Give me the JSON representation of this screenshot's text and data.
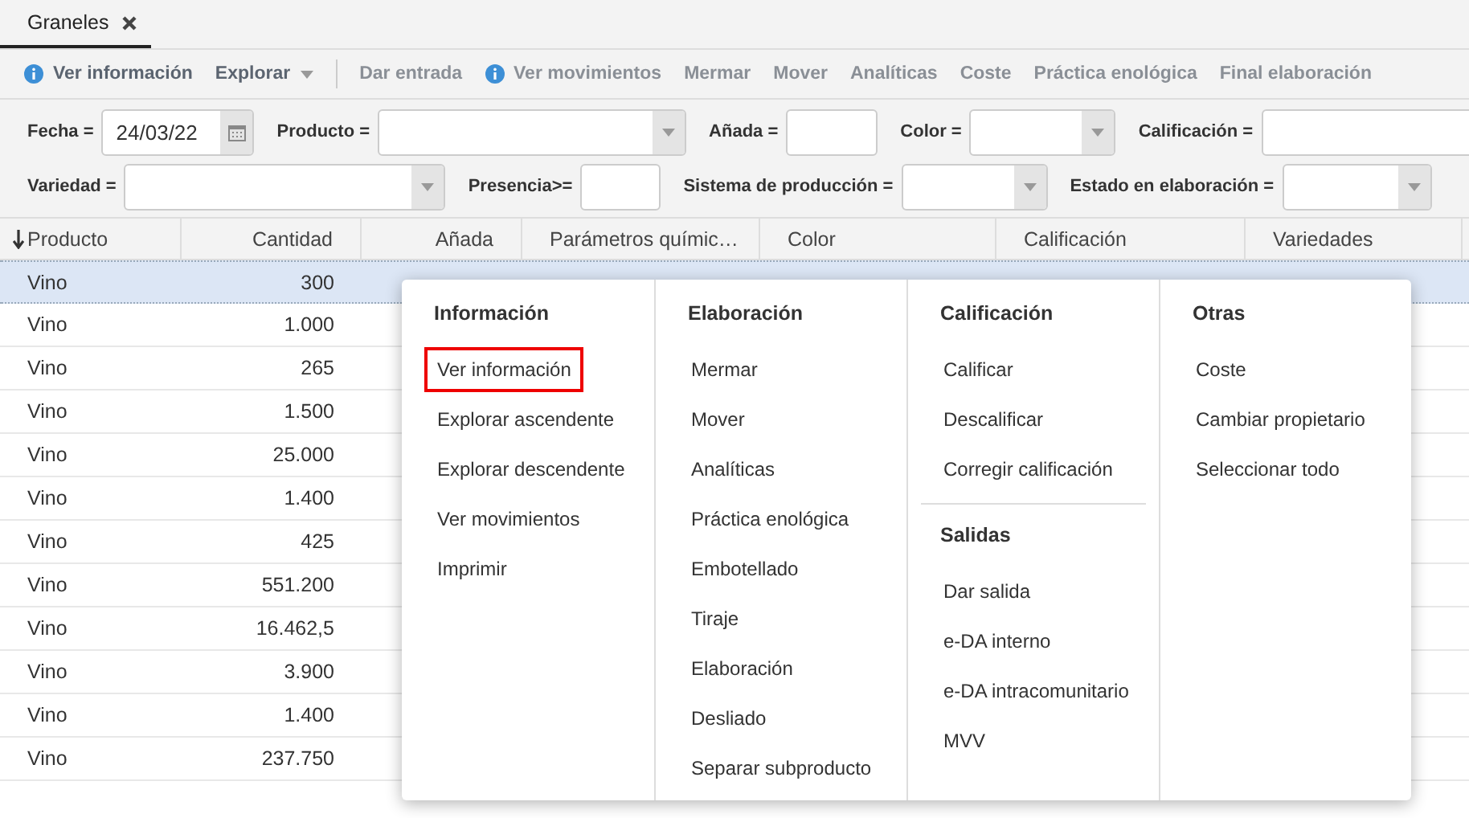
{
  "tabs": [
    {
      "label": "Graneles",
      "selected": true,
      "closable": true
    }
  ],
  "toolbar": [
    {
      "kind": "info",
      "label": "Ver información",
      "disabled": false
    },
    {
      "kind": "dropdown",
      "label": "Explorar",
      "disabled": false
    },
    {
      "kind": "separator"
    },
    {
      "kind": "plain",
      "label": "Dar entrada",
      "disabled": true
    },
    {
      "kind": "info",
      "label": "Ver movimientos",
      "disabled": true
    },
    {
      "kind": "plain",
      "label": "Mermar",
      "disabled": true
    },
    {
      "kind": "plain",
      "label": "Mover",
      "disabled": true
    },
    {
      "kind": "plain",
      "label": "Analíticas",
      "disabled": true
    },
    {
      "kind": "plain",
      "label": "Coste",
      "disabled": true
    },
    {
      "kind": "plain",
      "label": "Práctica enológica",
      "disabled": true
    },
    {
      "kind": "plain",
      "label": "Final elaboración",
      "disabled": true
    }
  ],
  "filters": [
    [
      {
        "label": "Fecha =",
        "kind": "date",
        "value": "24/03/22"
      },
      {
        "label": "Producto =",
        "kind": "select"
      },
      {
        "label": "Añada =",
        "kind": "text"
      },
      {
        "label": "Color =",
        "kind": "select"
      },
      {
        "label": "Calificación =",
        "kind": "text"
      }
    ],
    [
      {
        "label": "Variedad =",
        "kind": "select"
      },
      {
        "label": "Presencia>=",
        "kind": "text"
      },
      {
        "label": "Sistema de producción =",
        "kind": "select"
      },
      {
        "label": "Estado en elaboración =",
        "kind": "select"
      }
    ]
  ],
  "table": {
    "columns": [
      {
        "label": "Producto",
        "sorted": true
      },
      {
        "label": "Cantidad",
        "sorted": false
      },
      {
        "label": "Añada",
        "sorted": false
      },
      {
        "label": "Parámetros químic…",
        "sorted": false
      },
      {
        "label": "Color",
        "sorted": false
      },
      {
        "label": "Calificación",
        "sorted": false
      },
      {
        "label": "Variedades",
        "sorted": false
      }
    ],
    "rows": [
      {
        "selected": true,
        "cells": [
          "Vino",
          "300"
        ]
      },
      {
        "selected": false,
        "cells": [
          "Vino",
          "1.000"
        ]
      },
      {
        "selected": false,
        "cells": [
          "Vino",
          "265"
        ]
      },
      {
        "selected": false,
        "cells": [
          "Vino",
          "1.500"
        ]
      },
      {
        "selected": false,
        "cells": [
          "Vino",
          "25.000"
        ]
      },
      {
        "selected": false,
        "cells": [
          "Vino",
          "1.400"
        ]
      },
      {
        "selected": false,
        "cells": [
          "Vino",
          "425"
        ]
      },
      {
        "selected": false,
        "cells": [
          "Vino",
          "551.200"
        ]
      },
      {
        "selected": false,
        "cells": [
          "Vino",
          "16.462,5"
        ]
      },
      {
        "selected": false,
        "cells": [
          "Vino",
          "3.900"
        ]
      },
      {
        "selected": false,
        "cells": [
          "Vino",
          "1.400"
        ]
      },
      {
        "selected": false,
        "cells": [
          "Vino",
          "237.750"
        ]
      }
    ]
  },
  "context_menu": {
    "columns": [
      {
        "groups": [
          {
            "title": "Información",
            "items": [
              {
                "label": "Ver información",
                "selected": true
              },
              {
                "label": "Explorar ascendente",
                "selected": false
              },
              {
                "label": "Explorar descendente",
                "selected": false
              },
              {
                "label": "Ver movimientos",
                "selected": false
              },
              {
                "label": "Imprimir",
                "selected": false
              }
            ]
          }
        ]
      },
      {
        "groups": [
          {
            "title": "Elaboración",
            "items": [
              {
                "label": "Mermar",
                "selected": false
              },
              {
                "label": "Mover",
                "selected": false
              },
              {
                "label": "Analíticas",
                "selected": false
              },
              {
                "label": "Práctica enológica",
                "selected": false
              },
              {
                "label": "Embotellado",
                "selected": false
              },
              {
                "label": "Tiraje",
                "selected": false
              },
              {
                "label": "Elaboración",
                "selected": false
              },
              {
                "label": "Desliado",
                "selected": false
              },
              {
                "label": "Separar subproducto",
                "selected": false
              }
            ]
          }
        ]
      },
      {
        "groups": [
          {
            "title": "Calificación",
            "items": [
              {
                "label": "Calificar",
                "selected": false
              },
              {
                "label": "Descalificar",
                "selected": false
              },
              {
                "label": "Corregir calificación",
                "selected": false
              }
            ]
          },
          {
            "title": "Salidas",
            "items": [
              {
                "label": "Dar salida",
                "selected": false
              },
              {
                "label": "e-DA interno",
                "selected": false
              },
              {
                "label": "e-DA intracomunitario",
                "selected": false
              },
              {
                "label": "MVV",
                "selected": false
              }
            ]
          }
        ]
      },
      {
        "groups": [
          {
            "title": "Otras",
            "items": [
              {
                "label": "Coste",
                "selected": false
              },
              {
                "label": "Cambiar propietario",
                "selected": false
              },
              {
                "label": "Seleccionar todo",
                "selected": false
              }
            ]
          }
        ]
      }
    ]
  }
}
